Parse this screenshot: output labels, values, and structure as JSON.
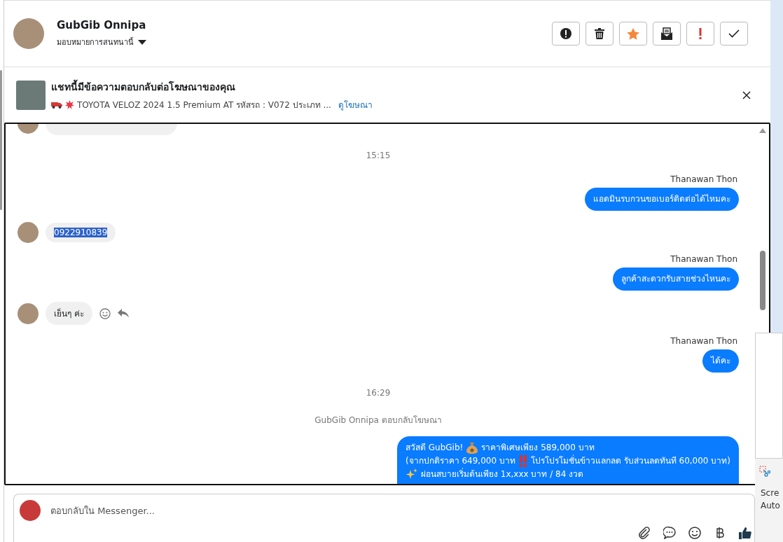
{
  "contact": {
    "name": "GubGib Onnipa",
    "assign_label": "มอบหมายการสนทนานี้"
  },
  "toolbar": [
    {
      "kind": "alert"
    },
    {
      "kind": "trash"
    },
    {
      "kind": "star"
    },
    {
      "kind": "mail"
    },
    {
      "kind": "important"
    },
    {
      "kind": "done"
    }
  ],
  "ad_banner": {
    "title": "แชทนี้มีข้อความตอบกลับต่อโฆษณาของคุณ",
    "snippet": "TOYOTA VELOZ 2024 1.5 Premium AT รหัสรถ : V072 ประเภท ...",
    "link": "ดูโฆษณา"
  },
  "messages": [
    {
      "kind": "clipped_in"
    },
    {
      "kind": "time",
      "text": "15:15"
    },
    {
      "kind": "sender",
      "text": "Thanawan Thon"
    },
    {
      "kind": "out",
      "lines": [
        [
          {
            "kind": "text",
            "text": "แอดมินรบกวนขอเบอร์ติดต่อได้ไหมคะ"
          }
        ]
      ]
    },
    {
      "kind": "in",
      "text": "0922910839",
      "highlighted": true,
      "actions": false
    },
    {
      "kind": "sender",
      "text": "Thanawan Thon"
    },
    {
      "kind": "out",
      "lines": [
        [
          {
            "kind": "text",
            "text": "ลูกค้าสะดวกรับสายช่วงไหนคะ"
          }
        ]
      ]
    },
    {
      "kind": "in",
      "text": "เย็นๆ ค่ะ",
      "highlighted": false,
      "actions": true
    },
    {
      "kind": "sender",
      "text": "Thanawan Thon"
    },
    {
      "kind": "out",
      "lines": [
        [
          {
            "kind": "text",
            "text": "ได้คะ"
          }
        ]
      ]
    },
    {
      "kind": "time",
      "text": "16:29"
    },
    {
      "kind": "system",
      "text": "GubGib Onnipa ตอบกลับโฆษณา"
    },
    {
      "kind": "out",
      "lines": [
        [
          {
            "kind": "text",
            "text": "สวัสดี GubGib!"
          },
          {
            "kind": "money-bag"
          },
          {
            "kind": "text",
            "text": "ราคาพิเศษเพียง 589,000 บาท"
          }
        ],
        [
          {
            "kind": "text",
            "text": "(จากปกติราคา 649,000 บาท"
          },
          {
            "kind": "double-exclamation"
          },
          {
            "kind": "text",
            "text": "โปรโปรโมชั่นข้าวแลกลด รับส่วนลดทันที 60,000 บาท)"
          }
        ],
        [
          {
            "kind": "sparkles"
          },
          {
            "kind": "text",
            "text": "ผ่อนสบายเริ่มต้นเพียง 1x,xxx บาท / 84 งวด"
          }
        ]
      ]
    }
  ],
  "composer": {
    "placeholder": "ตอบกลับใน Messenger..."
  },
  "notification": {
    "line_1": "Scre",
    "line_2": "Auto"
  }
}
